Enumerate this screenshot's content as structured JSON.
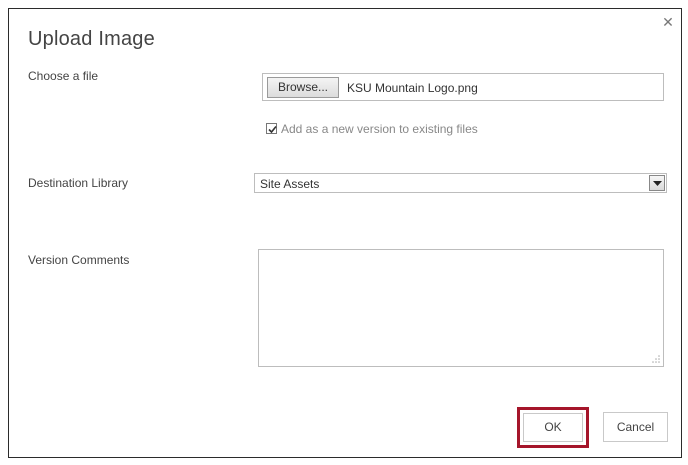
{
  "dialog": {
    "title": "Upload Image",
    "close_icon": "close-icon"
  },
  "fields": {
    "choose_file_label": "Choose a file",
    "browse_label": "Browse...",
    "file_name": "KSU Mountain Logo.png",
    "checkbox_label": "Add as a new version to existing files",
    "checkbox_checked": true,
    "destination_label": "Destination Library",
    "destination_value": "Site Assets",
    "version_comments_label": "Version Comments",
    "version_comments_value": ""
  },
  "buttons": {
    "ok_label": "OK",
    "cancel_label": "Cancel"
  },
  "colors": {
    "ok_highlight": "#a5152a"
  }
}
